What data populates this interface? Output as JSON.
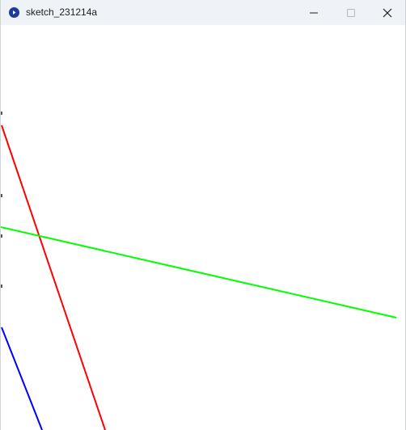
{
  "window": {
    "title": "sketch_231214a",
    "app_icon": "processing-app-icon",
    "controls": {
      "minimize_icon": "minimize-icon",
      "maximize_icon": "maximize-icon",
      "close_icon": "close-icon"
    }
  },
  "sketch": {
    "background": "#ffffff",
    "lines": [
      {
        "name": "red-line",
        "color": "#ff0000"
      },
      {
        "name": "green-line",
        "color": "#00ff00"
      },
      {
        "name": "blue-line",
        "color": "#0000ff"
      }
    ]
  }
}
